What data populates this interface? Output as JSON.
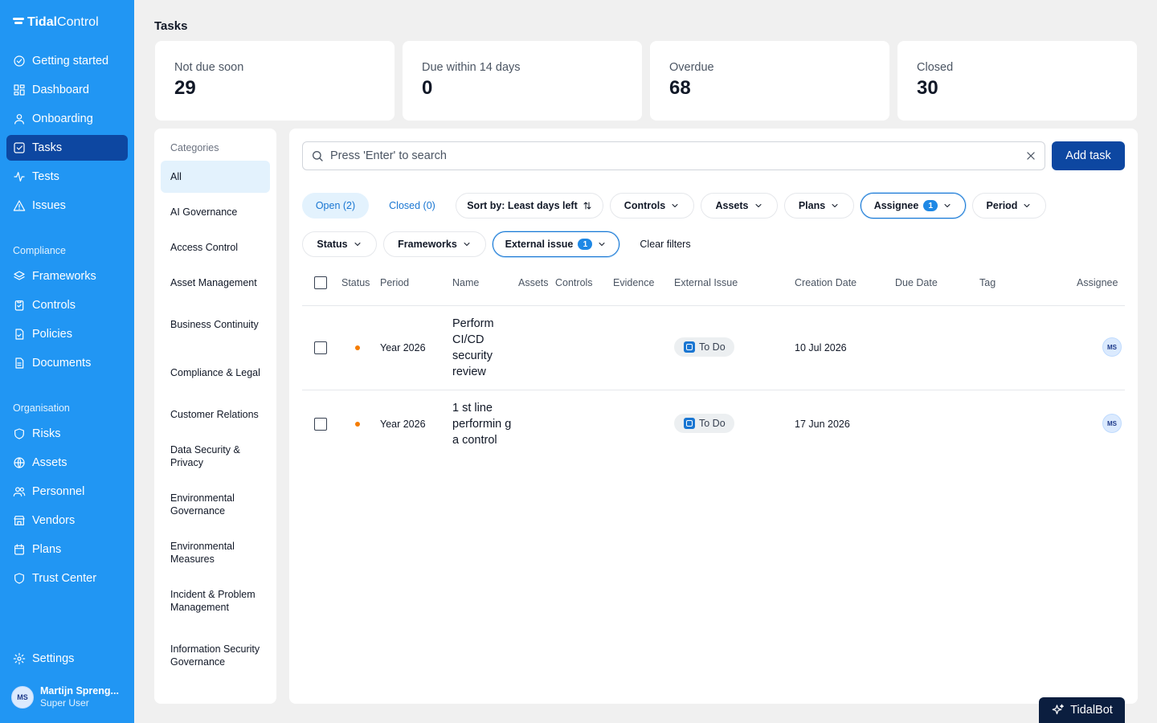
{
  "brand": {
    "part1": "Tidal",
    "part2": "Control"
  },
  "sidebar": {
    "items": [
      {
        "label": "Getting started",
        "icon": "rocket-icon"
      },
      {
        "label": "Dashboard",
        "icon": "grid-icon"
      },
      {
        "label": "Onboarding",
        "icon": "user-icon"
      },
      {
        "label": "Tasks",
        "icon": "checkbox-icon"
      },
      {
        "label": "Tests",
        "icon": "activity-icon"
      },
      {
        "label": "Issues",
        "icon": "warning-icon"
      }
    ],
    "compliance_label": "Compliance",
    "compliance_items": [
      {
        "label": "Frameworks",
        "icon": "layers-icon"
      },
      {
        "label": "Controls",
        "icon": "clipboard-icon"
      },
      {
        "label": "Policies",
        "icon": "file-check-icon"
      },
      {
        "label": "Documents",
        "icon": "file-text-icon"
      }
    ],
    "organisation_label": "Organisation",
    "organisation_items": [
      {
        "label": "Risks",
        "icon": "shield-icon"
      },
      {
        "label": "Assets",
        "icon": "globe-icon"
      },
      {
        "label": "Personnel",
        "icon": "users-icon"
      },
      {
        "label": "Vendors",
        "icon": "store-icon"
      },
      {
        "label": "Plans",
        "icon": "calendar-icon"
      },
      {
        "label": "Trust Center",
        "icon": "shield-check-icon"
      }
    ],
    "settings_label": "Settings",
    "user": {
      "initials": "MS",
      "name": "Martijn Spreng...",
      "role": "Super User"
    }
  },
  "page": {
    "title": "Tasks"
  },
  "stats": [
    {
      "label": "Not due soon",
      "value": "29"
    },
    {
      "label": "Due within 14 days",
      "value": "0"
    },
    {
      "label": "Overdue",
      "value": "68"
    },
    {
      "label": "Closed",
      "value": "30"
    }
  ],
  "categories": {
    "heading": "Categories",
    "items": [
      "All",
      "AI Governance",
      "Access Control",
      "Asset Management",
      "Business Continuity",
      "Compliance & Legal",
      "Customer Relations",
      "Data Security & Privacy",
      "Environmental Governance",
      "Environmental Measures",
      "Incident & Problem Management",
      "Information Security Governance"
    ]
  },
  "search": {
    "placeholder": "Press 'Enter' to search",
    "value": ""
  },
  "add_task_label": "Add task",
  "filters": {
    "open_tab": "Open (2)",
    "closed_tab": "Closed (0)",
    "sort": "Sort by: Least days left",
    "controls": "Controls",
    "assets": "Assets",
    "plans": "Plans",
    "assignee": "Assignee",
    "assignee_count": "1",
    "period": "Period",
    "status": "Status",
    "frameworks": "Frameworks",
    "external_issue": "External issue",
    "external_issue_count": "1",
    "clear": "Clear filters"
  },
  "table": {
    "headers": [
      "Status",
      "Period",
      "Name",
      "Assets",
      "Controls",
      "Evidence",
      "External Issue",
      "Creation Date",
      "Due Date",
      "Tag",
      "Assignee"
    ],
    "rows": [
      {
        "status_color": "#f57c00",
        "period": "Year 2026",
        "name": "Perform CI/CD security review",
        "external_issue": "To Do",
        "creation_date": "10 Jul 2026",
        "due_date": "",
        "tag": "",
        "assignee": "MS"
      },
      {
        "status_color": "#f57c00",
        "period": "Year 2026",
        "name": "1 st line performin g a control",
        "external_issue": "To Do",
        "creation_date": "17 Jun 2026",
        "due_date": "",
        "tag": "",
        "assignee": "MS"
      }
    ]
  },
  "tidalbot_label": "TidalBot",
  "colors": {
    "sidebar": "#2196f3",
    "active_nav": "#0d47a1",
    "accent": "#1976d2",
    "status_dot": "#f57c00"
  }
}
